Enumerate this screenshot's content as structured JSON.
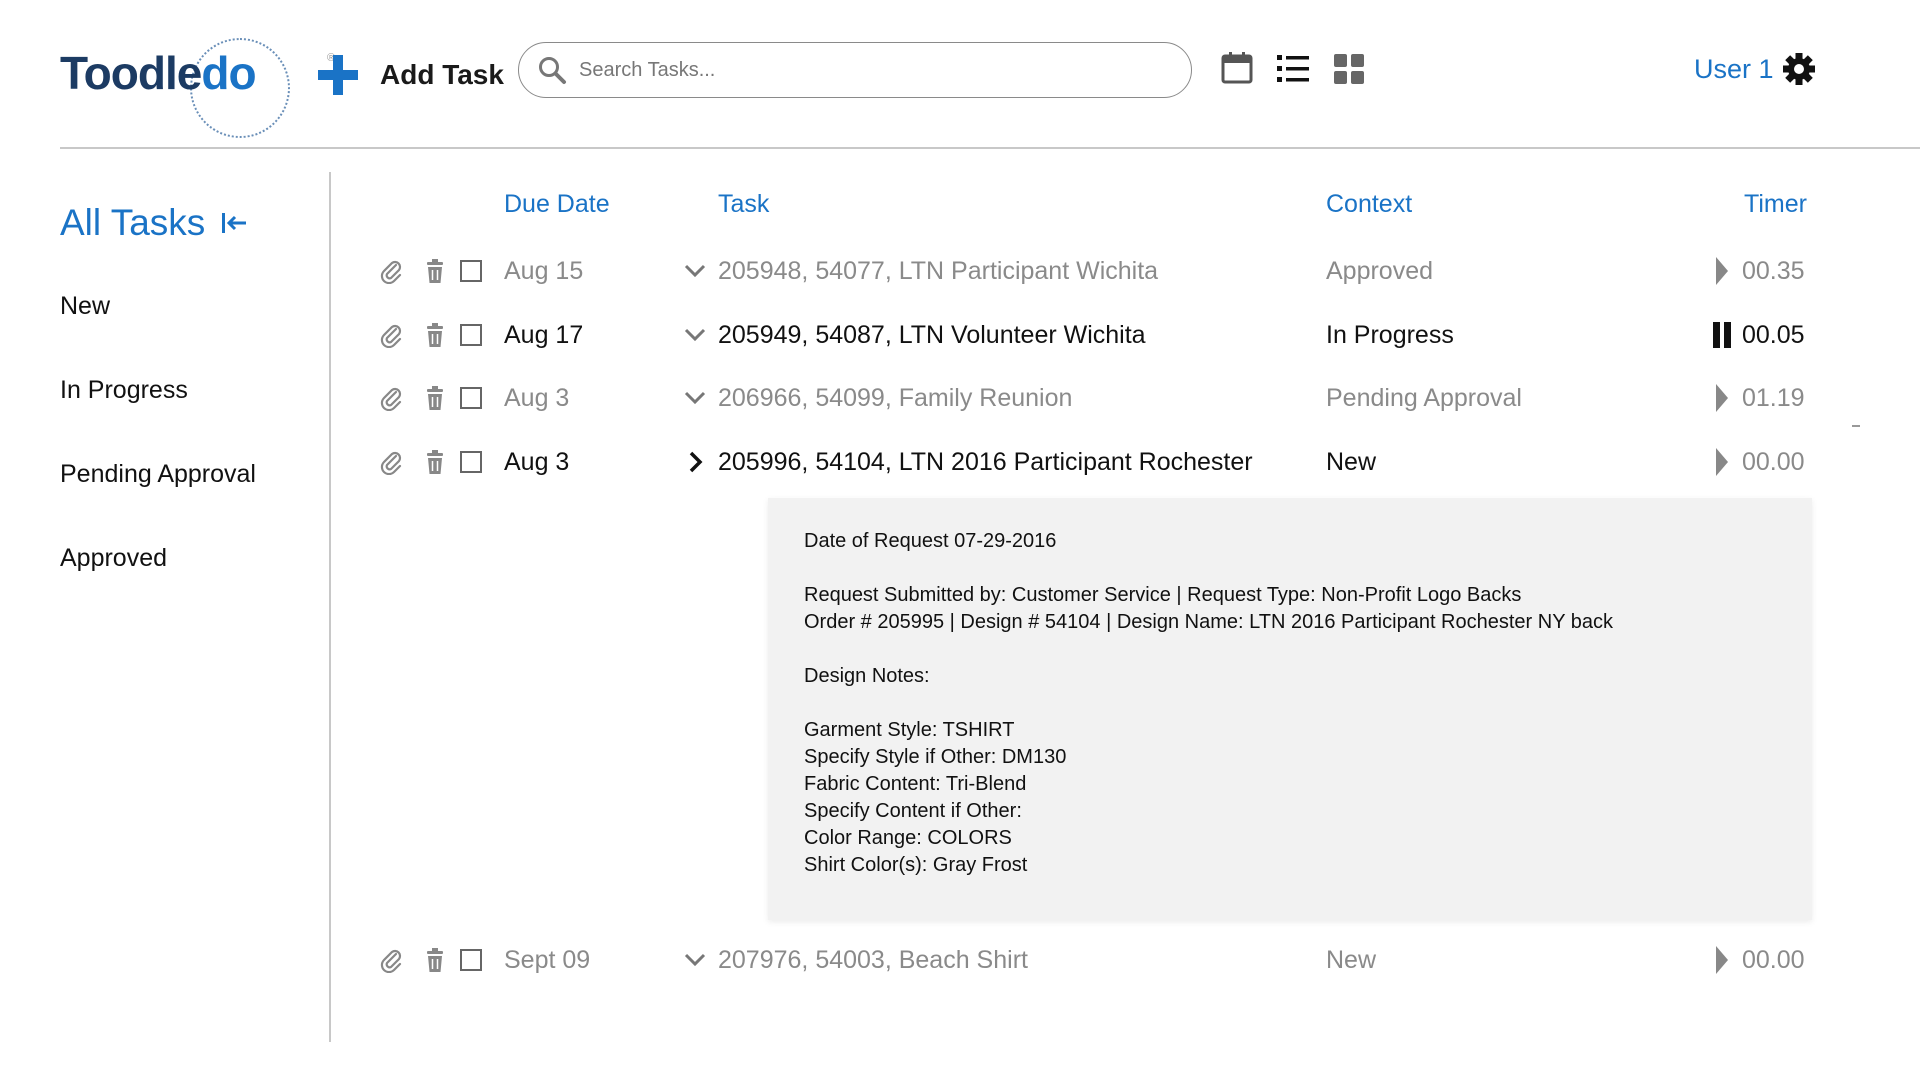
{
  "header": {
    "logo": {
      "text_part1": "Toodle",
      "text_part2": "do",
      "registered_mark": "®"
    },
    "add_task_label": "Add Task",
    "search": {
      "placeholder": "Search Tasks...",
      "value": ""
    },
    "view_icons": [
      "calendar-icon",
      "list-view-icon",
      "grid-view-icon"
    ],
    "user": {
      "name": "User 1",
      "icon": "gear-icon"
    }
  },
  "colors": {
    "accent": "#1a73c6",
    "logo_dark": "#1c3b63",
    "muted_text": "#8a8a8a",
    "panel_bg": "#f2f2f2"
  },
  "sidebar": {
    "title": "All Tasks",
    "items": [
      {
        "label": "New"
      },
      {
        "label": "In Progress"
      },
      {
        "label": "Pending Approval"
      },
      {
        "label": "Approved"
      }
    ]
  },
  "columns": {
    "due_date": "Due Date",
    "task": "Task",
    "context": "Context",
    "timer": "Timer"
  },
  "tasks": [
    {
      "due": "Aug 15",
      "title": "205948, 54077, LTN Participant Wichita",
      "context": "Approved",
      "timer": "00.35",
      "timer_state": "stopped",
      "expanded": false,
      "muted": true
    },
    {
      "due": "Aug 17",
      "title": "205949, 54087, LTN Volunteer Wichita",
      "context": "In Progress",
      "timer": "00.05",
      "timer_state": "running",
      "expanded": false,
      "muted": false
    },
    {
      "due": "Aug 3",
      "title": "206966, 54099, Family Reunion",
      "context": "Pending Approval",
      "timer": "01.19",
      "timer_state": "stopped",
      "expanded": false,
      "muted": true
    },
    {
      "due": "Aug 3",
      "title": "205996, 54104, LTN 2016 Participant Rochester",
      "context": "New",
      "timer": "00.00",
      "timer_state": "stopped",
      "expanded": true,
      "muted": false
    },
    {
      "due": "Sept 09",
      "title": "207976, 54003, Beach Shirt",
      "context": "New",
      "timer": "00.00",
      "timer_state": "stopped",
      "expanded": false,
      "muted": true
    }
  ],
  "notes": [
    "Date of Request 07-29-2016",
    "",
    "Request Submitted by: Customer Service | Request Type: Non-Profit Logo Backs",
    "Order # 205995 | Design # 54104 | Design Name: LTN 2016 Participant Rochester NY back",
    "",
    "Design Notes:",
    "",
    "Garment Style: TSHIRT",
    "Specify Style if Other: DM130",
    "Fabric Content: Tri-Blend",
    "Specify Content if Other:",
    "Color Range: COLORS",
    "Shirt Color(s): Gray Frost"
  ]
}
